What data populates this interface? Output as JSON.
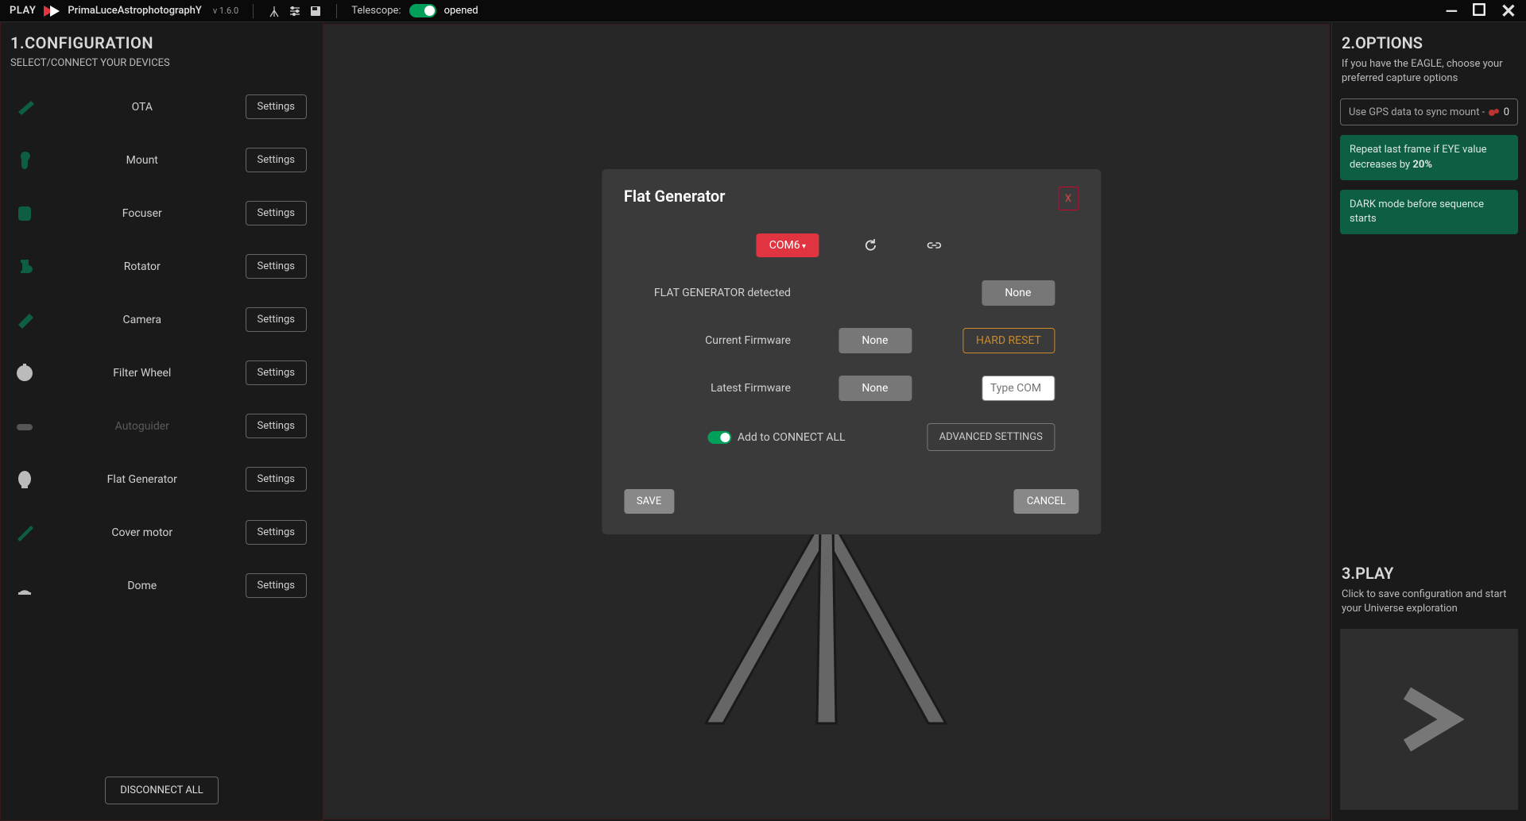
{
  "topbar": {
    "play": "PLAY",
    "brand": "PrimaLuceAstrophotographY",
    "version": "v 1.6.0",
    "telescope_label": "Telescope:",
    "telescope_status": "opened"
  },
  "sidebar_left": {
    "title": "1.CONFIGURATION",
    "subtitle": "SELECT/CONNECT YOUR DEVICES",
    "devices": [
      {
        "label": "OTA",
        "settings": "Settings",
        "color": "#0d5e42",
        "disabled": false
      },
      {
        "label": "Mount",
        "settings": "Settings",
        "color": "#0d5e42",
        "disabled": false
      },
      {
        "label": "Focuser",
        "settings": "Settings",
        "color": "#0d5e42",
        "disabled": false
      },
      {
        "label": "Rotator",
        "settings": "Settings",
        "color": "#0d5e42",
        "disabled": false
      },
      {
        "label": "Camera",
        "settings": "Settings",
        "color": "#0d5e42",
        "disabled": false
      },
      {
        "label": "Filter Wheel",
        "settings": "Settings",
        "color": "#bbb",
        "disabled": false
      },
      {
        "label": "Autoguider",
        "settings": "Settings",
        "color": "#555",
        "disabled": true
      },
      {
        "label": "Flat Generator",
        "settings": "Settings",
        "color": "#bbb",
        "disabled": false
      },
      {
        "label": "Cover motor",
        "settings": "Settings",
        "color": "#0d5e42",
        "disabled": false
      },
      {
        "label": "Dome",
        "settings": "Settings",
        "color": "#bbb",
        "disabled": false
      }
    ],
    "disconnect": "DISCONNECT ALL"
  },
  "modal": {
    "title": "Flat Generator",
    "close": "X",
    "com": "COM6",
    "detected_label": "FLAT GENERATOR detected",
    "detected_value": "None",
    "current_fw_label": "Current Firmware",
    "current_fw_value": "None",
    "hard_reset": "HARD RESET",
    "latest_fw_label": "Latest Firmware",
    "latest_fw_value": "None",
    "com_placeholder": "Type COM",
    "connect_all": "Add to CONNECT ALL",
    "advanced": "ADVANCED SETTINGS",
    "save": "SAVE",
    "cancel": "CANCEL"
  },
  "sidebar_right": {
    "options_title": "2.OPTIONS",
    "options_subtitle": "If you have the EAGLE, choose your preferred capture options",
    "gps_label": "Use GPS data to sync mount  -",
    "gps_value": "0",
    "opt1_prefix": "Repeat last frame if EYE value decreases by ",
    "opt1_bold": "20%",
    "opt2": "DARK mode before sequence starts",
    "play_title": "3.PLAY",
    "play_subtitle": "Click to save configuration and start your Universe exploration"
  }
}
